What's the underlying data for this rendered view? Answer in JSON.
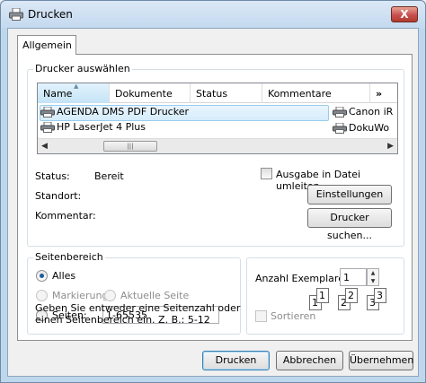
{
  "window": {
    "title": "Drucken",
    "close_glyph": "X"
  },
  "tabs": [
    {
      "label": "Allgemein"
    }
  ],
  "printer_select": {
    "group_label": "Drucker auswählen",
    "columns": [
      "Name",
      "Dokumente",
      "Status",
      "Kommentare",
      "»"
    ],
    "printers": [
      {
        "name": "AGENDA DMS PDF Drucker",
        "selected": true
      },
      {
        "name": "HP LaserJet 4 Plus",
        "selected": false
      },
      {
        "name": "Canon iR",
        "selected": false
      },
      {
        "name": "DokuWo",
        "selected": false
      }
    ],
    "status_label": "Status:",
    "status_value": "Bereit",
    "location_label": "Standort:",
    "comment_label": "Kommentar:",
    "print_to_file_label": "Ausgabe in Datei umleiten",
    "settings_button": "Einstellungen",
    "find_printer_button": "Drucker suchen..."
  },
  "page_range": {
    "group_label": "Seitenbereich",
    "all_label": "Alles",
    "selection_label": "Markierung",
    "current_page_label": "Aktuelle Seite",
    "pages_label": "Seiten:",
    "pages_value": "1-65535",
    "help_line1": "Geben Sie entweder eine Seitenzahl oder",
    "help_line2": "einen Seitenbereich ein. Z. B.: 5-12"
  },
  "copies": {
    "copies_label": "Anzahl Exemplare:",
    "copies_value": "1",
    "collate_label": "Sortieren",
    "collate_pages": [
      "1",
      "1",
      "2",
      "2",
      "3",
      "3"
    ]
  },
  "footer": {
    "print_button": "Drucken",
    "cancel_button": "Abbrechen",
    "apply_button": "Übernehmen"
  }
}
